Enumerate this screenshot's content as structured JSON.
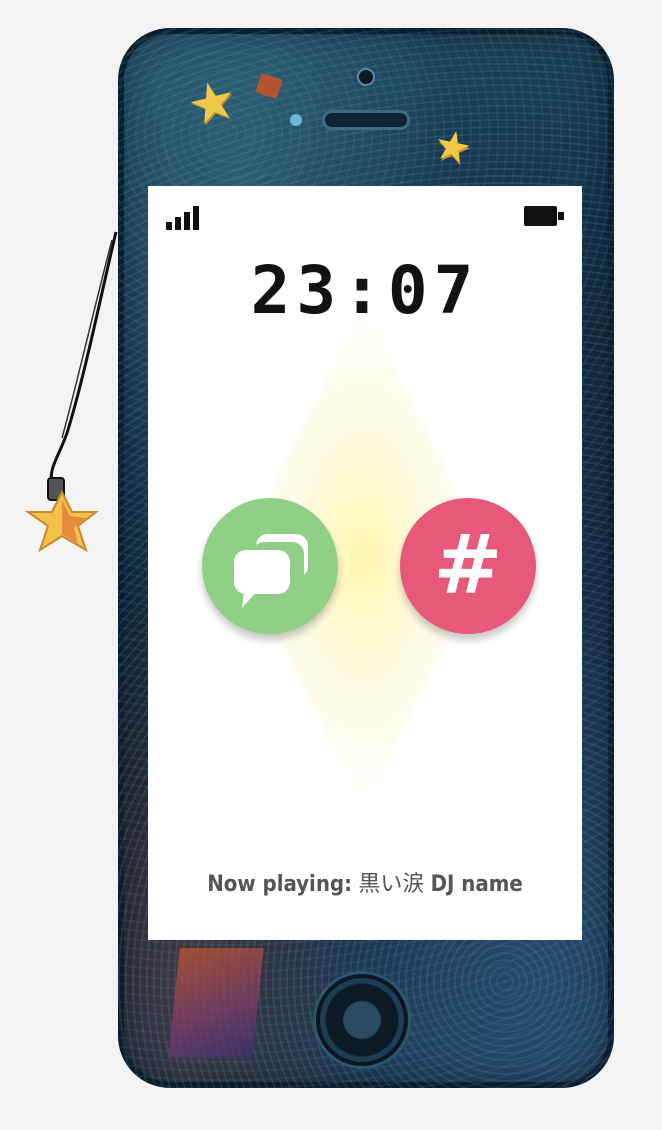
{
  "status_bar": {
    "signal_icon": "signal-bars-icon",
    "battery_icon": "battery-full-icon"
  },
  "clock": {
    "time": "23:07"
  },
  "apps": [
    {
      "name": "chat",
      "icon": "chat-bubbles-icon",
      "color": "#8fcf86"
    },
    {
      "name": "hashtag",
      "icon": "hashtag-icon",
      "glyph": "#",
      "color": "#e8587a"
    }
  ],
  "now_playing": {
    "label": "Now playing:",
    "title": "黒い涙",
    "artist": "DJ name"
  },
  "decorations": {
    "star_glyph": "★",
    "charm_icon": "star-charm-icon"
  }
}
